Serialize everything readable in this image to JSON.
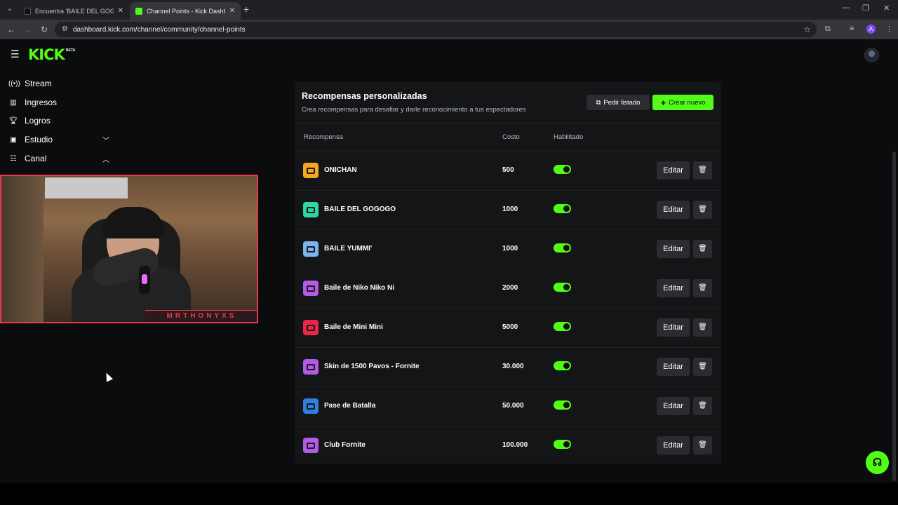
{
  "browser": {
    "tabs": [
      {
        "title": "Encuentra 'BAILE DEL GOGOGO'",
        "active": false
      },
      {
        "title": "Channel Points - Kick Dashboard",
        "active": true
      }
    ],
    "url": "dashboard.kick.com/channel/community/channel-points",
    "profile_initial": "A"
  },
  "header": {
    "logo": "KICK",
    "logo_badge": "BETA"
  },
  "sidebar": {
    "items": [
      {
        "label": "Stream"
      },
      {
        "label": "Ingresos"
      },
      {
        "label": "Logros"
      },
      {
        "label": "Estudio"
      },
      {
        "label": "Canal"
      }
    ]
  },
  "webcam": {
    "nameplate": "MRTHONYXS"
  },
  "rewards": {
    "title": "Recompensas personalizadas",
    "subtitle": "Crea recompensas para desafiar y darle reconocimiento a tus espectadores",
    "btn_pedir": "Pedir listado",
    "btn_crear": "Crear nuevo",
    "col_recompensa": "Recompensa",
    "col_costo": "Costo",
    "col_habilitado": "Habilitado",
    "edit_label": "Editar",
    "rows": [
      {
        "name": "ONICHAN",
        "cost": "500",
        "enabled": true,
        "color": "#f5a623"
      },
      {
        "name": "BAILE DEL GOGOGO",
        "cost": "1000",
        "enabled": true,
        "color": "#2fd6a5"
      },
      {
        "name": "BAILE YUMMI'",
        "cost": "1000",
        "enabled": true,
        "color": "#7fb3f0"
      },
      {
        "name": "Baile de Niko Niko Ni",
        "cost": "2000",
        "enabled": true,
        "color": "#b45ae8"
      },
      {
        "name": "Baile de Mini Mini",
        "cost": "5000",
        "enabled": true,
        "color": "#e8274b"
      },
      {
        "name": "Skin de 1500 Pavos - Fornite",
        "cost": "30.000",
        "enabled": true,
        "color": "#b45ae8"
      },
      {
        "name": "Pase de Batalla",
        "cost": "50.000",
        "enabled": true,
        "color": "#2e7fe0"
      },
      {
        "name": "Club Fornite",
        "cost": "100.000",
        "enabled": true,
        "color": "#b45ae8"
      }
    ]
  },
  "colors": {
    "accent": "#53fc18",
    "background": "#0b0c0d",
    "panel": "#141517"
  }
}
